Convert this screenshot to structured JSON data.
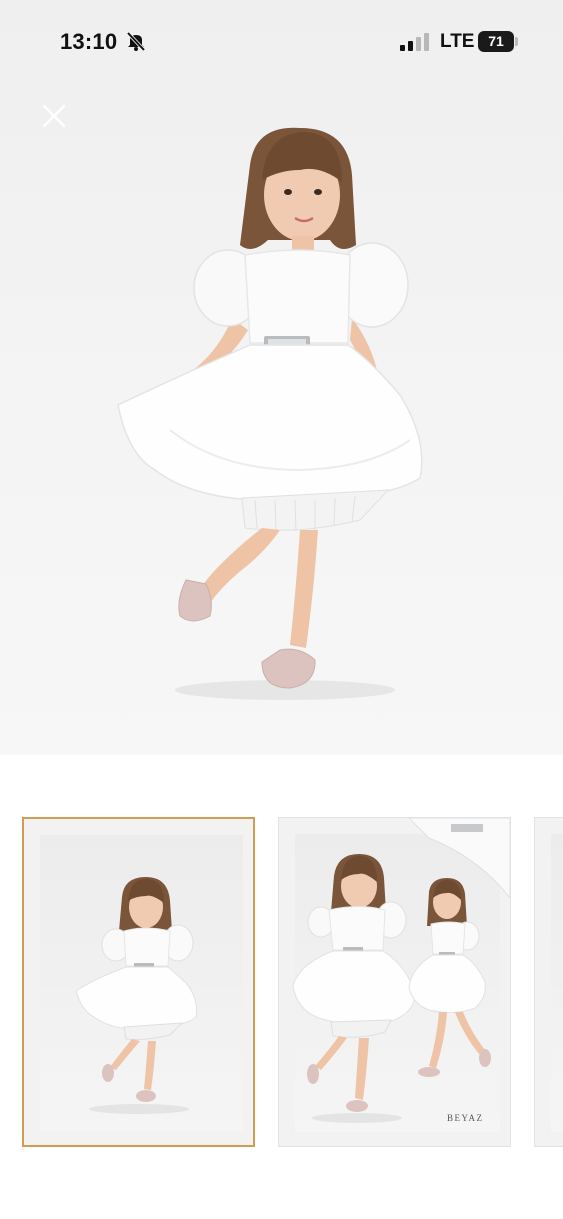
{
  "status_bar": {
    "time": "13:10",
    "network": "LTE",
    "battery": "71",
    "icons": [
      "bell-slash-icon",
      "signal-icon",
      "battery-icon"
    ]
  },
  "viewer": {
    "close_icon": "close-icon",
    "main_image": "girl-white-dress-photo"
  },
  "thumbnails": [
    {
      "name": "thumbnail-1",
      "selected": true
    },
    {
      "name": "thumbnail-2",
      "selected": false,
      "caption": "BEYAZ"
    },
    {
      "name": "thumbnail-3",
      "selected": false
    }
  ],
  "colors": {
    "selected_border": "#d29b52",
    "dress": "#ffffff",
    "hair": "#7a5539",
    "skin": "#eec3a6",
    "shoes": "#dcc3bf"
  }
}
